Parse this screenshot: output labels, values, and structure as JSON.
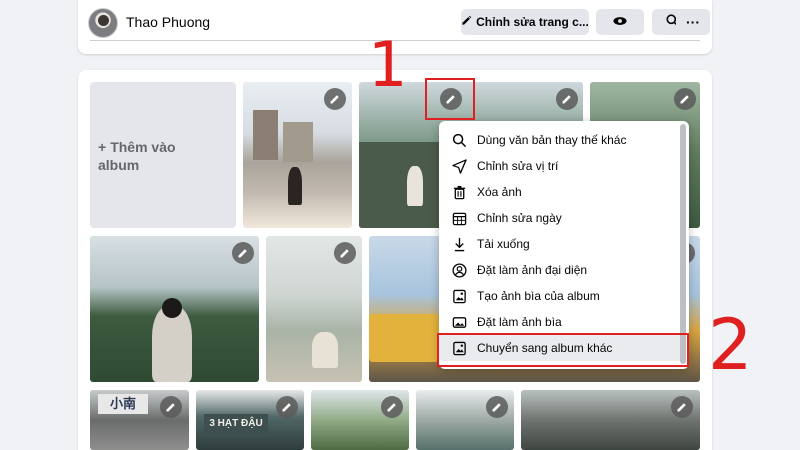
{
  "header": {
    "profile_name": "Thao Phuong",
    "edit_profile_label": "Chỉnh sửa trang c...",
    "more_label": "···"
  },
  "album": {
    "add_label": "Thêm vào album"
  },
  "menu": {
    "items": [
      {
        "label": "Dùng văn bản thay thế khác",
        "icon": "search-icon"
      },
      {
        "label": "Chỉnh sửa vị trí",
        "icon": "location-arrow-icon"
      },
      {
        "label": "Xóa ảnh",
        "icon": "trash-icon"
      },
      {
        "label": "Chỉnh sửa ngày",
        "icon": "calendar-icon"
      },
      {
        "label": "Tải xuống",
        "icon": "download-icon"
      },
      {
        "label": "Đặt làm ảnh đại diện",
        "icon": "profile-circle-icon"
      },
      {
        "label": "Tạo ảnh bìa của album",
        "icon": "album-cover-icon"
      },
      {
        "label": "Đặt làm ảnh bìa",
        "icon": "image-icon"
      },
      {
        "label": "Chuyển sang album khác",
        "icon": "move-album-icon"
      }
    ]
  },
  "annotations": {
    "step1": "1",
    "step2": "2"
  },
  "signs": {
    "sign1": "小南",
    "sign2": "3 HẠT ĐẬU"
  },
  "colors": {
    "accent_red": "#e02020",
    "button_bg": "#e4e6eb",
    "menu_highlight": "#e9ebee"
  }
}
